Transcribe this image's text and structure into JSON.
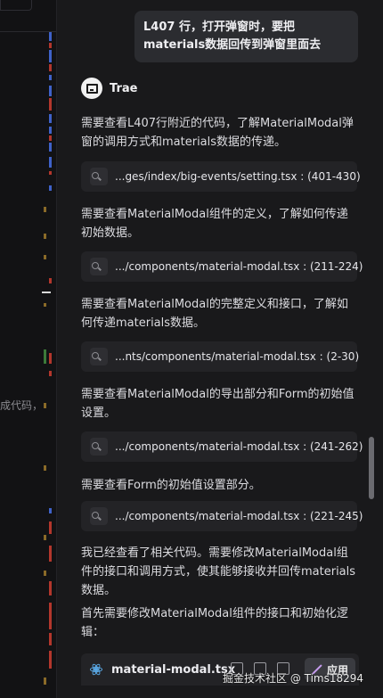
{
  "editor": {
    "cut_text": "成代码，"
  },
  "chat": {
    "user_message": "L407 行，打开弹窗时，要把materials数据回传到弹窗里面去",
    "agent_name": "Trae",
    "steps": [
      {
        "text": "需要查看L407行附近的代码，了解MaterialModal弹窗的调用方式和materials数据的传递。",
        "file": "...ges/index/big-events/setting.tsx : (401-430)"
      },
      {
        "text": "需要查看MaterialModal组件的定义，了解如何传递初始数据。",
        "file": ".../components/material-modal.tsx : (211-224)"
      },
      {
        "text": "需要查看MaterialModal的完整定义和接口，了解如何传递materials数据。",
        "file": "...nts/components/material-modal.tsx : (2-30)"
      },
      {
        "text": "需要查看MaterialModal的导出部分和Form的初始值设置。",
        "file": ".../components/material-modal.tsx : (241-262)"
      },
      {
        "text": "需要查看Form的初始值设置部分。",
        "file": ".../components/material-modal.tsx : (221-245)"
      }
    ],
    "summary_1": "我已经查看了相关代码。需要修改MaterialModal组件的接口和调用方式，使其能够接收并回传materials数据。",
    "summary_2": "首先需要修改MaterialModal组件的接口和初始化逻辑：",
    "code_block": {
      "file_name": "material-modal.tsx",
      "apply_label": "应用"
    }
  },
  "watermark": "掘金技术社区 @ Tims18294",
  "colors": {
    "panel_bg": "#19191b",
    "bubble_bg": "#2b2c30",
    "file_ref_bg": "#232326",
    "react_blue": "#5aa9e6"
  },
  "icons": [
    "search-icon",
    "react-file-icon",
    "copy-icon",
    "insert-icon",
    "new-file-icon",
    "apply-wand-icon",
    "trae-logo-icon"
  ]
}
